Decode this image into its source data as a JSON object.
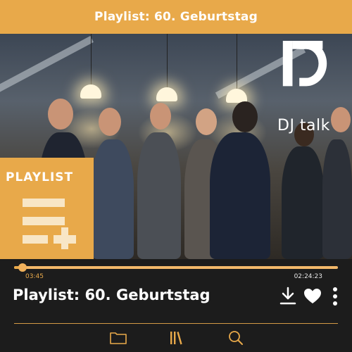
{
  "header": {
    "title": "Playlist: 60. Geburtstag"
  },
  "banner": {
    "brand_logo_icon": "dj-logo-icon",
    "brand_text": "DJ talk",
    "card_title": "PLAYLIST",
    "card_icon": "playlist-add-icon"
  },
  "player": {
    "elapsed": "03:45",
    "total": "02:24:23",
    "progress": 0.0253,
    "track_title": "Playlist: 60. Geburtstag",
    "actions": [
      "download-icon",
      "heart-icon",
      "more-vertical-icon"
    ]
  },
  "nav": {
    "items": [
      "folder-icon",
      "library-icon",
      "search-icon"
    ]
  },
  "colors": {
    "accent": "#e8a94a",
    "background": "#1c1c1c",
    "text": "#ffffff"
  }
}
